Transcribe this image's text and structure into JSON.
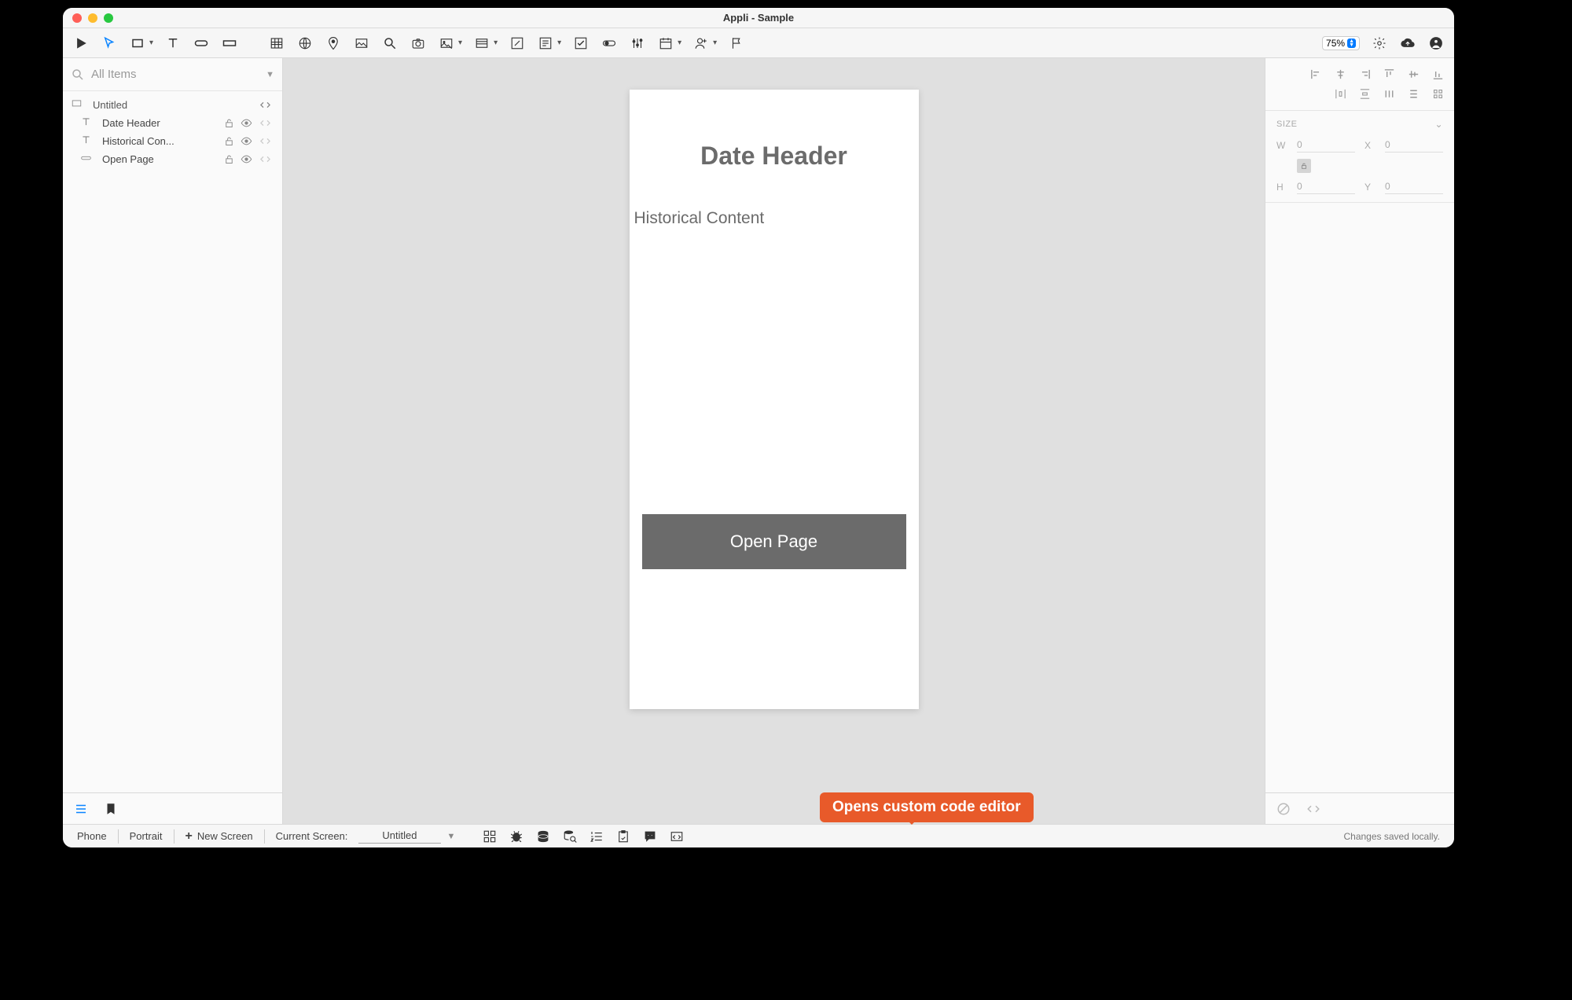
{
  "window": {
    "title": "Appli - Sample"
  },
  "toolbar": {
    "zoom": "75%"
  },
  "left": {
    "search_placeholder": "All Items",
    "root": "Untitled",
    "items": [
      {
        "label": "Date Header"
      },
      {
        "label": "Historical Con..."
      },
      {
        "label": "Open Page"
      }
    ]
  },
  "canvas": {
    "header": "Date Header",
    "subtitle": "Historical Content",
    "button": "Open Page"
  },
  "inspector": {
    "size_label": "SIZE",
    "w_label": "W",
    "w_value": "0",
    "x_label": "X",
    "x_value": "0",
    "h_label": "H",
    "h_value": "0",
    "y_label": "Y",
    "y_value": "0"
  },
  "statusbar": {
    "device": "Phone",
    "orientation": "Portrait",
    "new_screen": "New Screen",
    "current_screen_label": "Current Screen:",
    "current_screen_value": "Untitled",
    "save_status": "Changes saved locally."
  },
  "tooltip": "Opens custom code editor"
}
